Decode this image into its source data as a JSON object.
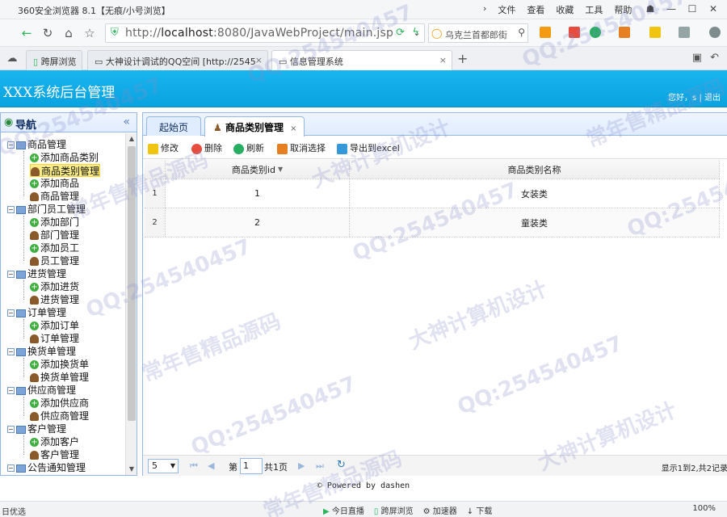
{
  "browser": {
    "title": "360安全浏览器 8.1【无痕/小号浏览】",
    "menus": [
      "文件",
      "查看",
      "收藏",
      "工具",
      "帮助"
    ],
    "url_prefix": "http://",
    "url_host": "localhost",
    "url_path": ":8080/JavaWebProject/main.jsp",
    "search_text": "乌克兰首都郎街",
    "tabs": [
      {
        "label": "跨屏浏览"
      },
      {
        "label": "大神设计调试的QQ空间 [http://2545"
      },
      {
        "label": "信息管理系统"
      }
    ]
  },
  "app": {
    "system_title": "XXX系统后台管理",
    "greeting": "您好，s",
    "logout": "退出",
    "separator": "|"
  },
  "sidebar": {
    "title": "导航",
    "tree": [
      {
        "label": "商品管理",
        "type": "group"
      },
      {
        "label": "添加商品类别",
        "type": "add"
      },
      {
        "label": "商品类别管理",
        "type": "manage",
        "selected": true
      },
      {
        "label": "添加商品",
        "type": "add"
      },
      {
        "label": "商品管理",
        "type": "manage"
      },
      {
        "label": "部门员工管理",
        "type": "group"
      },
      {
        "label": "添加部门",
        "type": "add"
      },
      {
        "label": "部门管理",
        "type": "manage"
      },
      {
        "label": "添加员工",
        "type": "add"
      },
      {
        "label": "员工管理",
        "type": "manage"
      },
      {
        "label": "进货管理",
        "type": "group"
      },
      {
        "label": "添加进货",
        "type": "add"
      },
      {
        "label": "进货管理",
        "type": "manage"
      },
      {
        "label": "订单管理",
        "type": "group"
      },
      {
        "label": "添加订单",
        "type": "add"
      },
      {
        "label": "订单管理",
        "type": "manage"
      },
      {
        "label": "换货单管理",
        "type": "group"
      },
      {
        "label": "添加换货单",
        "type": "add"
      },
      {
        "label": "换货单管理",
        "type": "manage"
      },
      {
        "label": "供应商管理",
        "type": "group"
      },
      {
        "label": "添加供应商",
        "type": "add"
      },
      {
        "label": "供应商管理",
        "type": "manage"
      },
      {
        "label": "客户管理",
        "type": "group"
      },
      {
        "label": "添加客户",
        "type": "add"
      },
      {
        "label": "客户管理",
        "type": "manage"
      },
      {
        "label": "公告通知管理",
        "type": "group"
      }
    ]
  },
  "content_tabs": [
    {
      "label": "起始页"
    },
    {
      "label": "商品类别管理",
      "close": "×"
    }
  ],
  "toolbar": {
    "edit": "修改",
    "delete": "删除",
    "refresh": "刷新",
    "cancel_select": "取消选择",
    "export": "导出到excel"
  },
  "grid": {
    "columns": [
      "商品类别id",
      "商品类别名称"
    ],
    "rows": [
      {
        "num": "1",
        "id": "1",
        "name": "女装类"
      },
      {
        "num": "2",
        "id": "2",
        "name": "童装类"
      }
    ]
  },
  "pager": {
    "page_size": "5",
    "page_label": "第",
    "page_value": "1",
    "total_pages": "共1页",
    "info": "显示1到2,共2记录"
  },
  "footer": "© Powered by dashen",
  "statusbar": {
    "left": "日优选",
    "items": [
      "今日直播",
      "跨屏浏览",
      "加速器",
      "下载"
    ],
    "zoom": "100%"
  },
  "watermarks": [
    "QQ:254540457",
    "大神计算机设计",
    "常年售精品源码"
  ],
  "colors": {
    "header_blue": "#09a3e0",
    "panel_border": "#95b8e7",
    "selected_bg": "#fbec88"
  }
}
